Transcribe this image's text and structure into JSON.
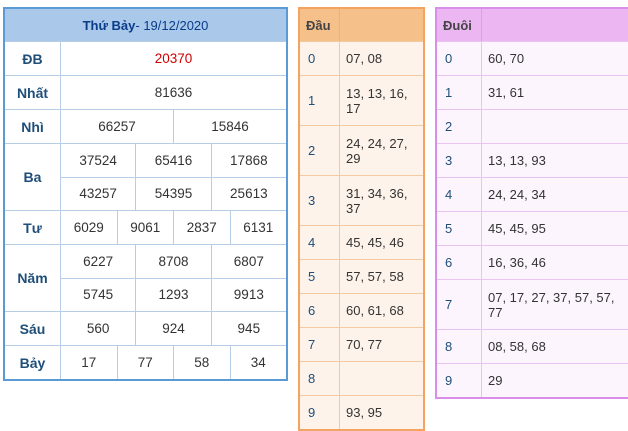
{
  "results": {
    "title_prefix": "Thứ Bảy",
    "title_date": " - 19/12/2020",
    "rows": [
      {
        "label": "ĐB",
        "lines": [
          [
            "20370"
          ]
        ],
        "special": true
      },
      {
        "label": "Nhất",
        "lines": [
          [
            "81636"
          ]
        ]
      },
      {
        "label": "Nhì",
        "lines": [
          [
            "66257",
            "15846"
          ]
        ]
      },
      {
        "label": "Ba",
        "lines": [
          [
            "37524",
            "65416",
            "17868"
          ],
          [
            "43257",
            "54395",
            "25613"
          ]
        ]
      },
      {
        "label": "Tư",
        "lines": [
          [
            "6029",
            "9061",
            "2837",
            "6131"
          ]
        ]
      },
      {
        "label": "Năm",
        "lines": [
          [
            "6227",
            "8708",
            "6807"
          ],
          [
            "5745",
            "1293",
            "9913"
          ]
        ]
      },
      {
        "label": "Sáu",
        "lines": [
          [
            "560",
            "924",
            "945"
          ]
        ]
      },
      {
        "label": "Bảy",
        "lines": [
          [
            "17",
            "77",
            "58",
            "34"
          ]
        ]
      }
    ]
  },
  "dau": {
    "header": "Đầu",
    "rows": [
      {
        "k": "0",
        "v": "07, 08"
      },
      {
        "k": "1",
        "v": "13, 13, 16, 17"
      },
      {
        "k": "2",
        "v": "24, 24, 27, 29"
      },
      {
        "k": "3",
        "v": "31, 34, 36, 37"
      },
      {
        "k": "4",
        "v": "45, 45, 46"
      },
      {
        "k": "5",
        "v": "57, 57, 58"
      },
      {
        "k": "6",
        "v": "60, 61, 68"
      },
      {
        "k": "7",
        "v": "70, 77"
      },
      {
        "k": "8",
        "v": ""
      },
      {
        "k": "9",
        "v": "93, 95"
      }
    ]
  },
  "duoi": {
    "header": "Đuôi",
    "rows": [
      {
        "k": "0",
        "v": "60, 70"
      },
      {
        "k": "1",
        "v": "31, 61"
      },
      {
        "k": "2",
        "v": ""
      },
      {
        "k": "3",
        "v": "13, 13, 93"
      },
      {
        "k": "4",
        "v": "24, 24, 34"
      },
      {
        "k": "5",
        "v": "45, 45, 95"
      },
      {
        "k": "6",
        "v": "16, 36, 46"
      },
      {
        "k": "7",
        "v": "07, 17, 27, 37, 57, 57, 77"
      },
      {
        "k": "8",
        "v": "08, 58, 68"
      },
      {
        "k": "9",
        "v": "29"
      }
    ]
  },
  "colors": {
    "special_prize": "#d00000",
    "results_header": "#a9c8ea",
    "dau_header": "#f6c08b",
    "duoi_header": "#ecb6f2"
  }
}
